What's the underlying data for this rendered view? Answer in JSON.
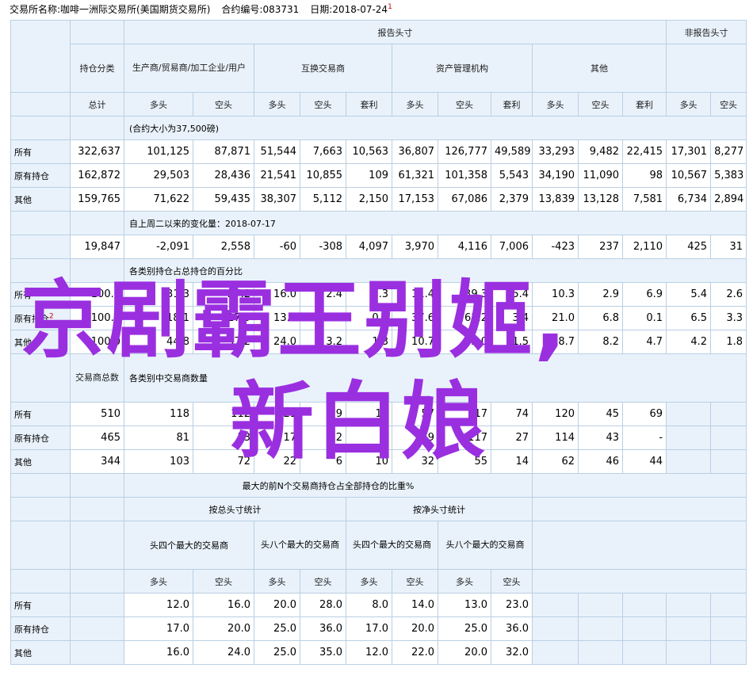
{
  "header": {
    "exchange": "交易所名称:咖啡一洲际交易所(美国期货交易所)",
    "contract": "合约编号:083731",
    "date": "日期:2018-07-24",
    "mark": "1"
  },
  "headers": {
    "report": "报告头寸",
    "nonreport": "非报告头寸",
    "holding_class": "持仓分类",
    "producer": "生产商/贸易商/加工企业/用户",
    "swap": "互换交易商",
    "money": "资产管理机构",
    "other": "其他",
    "total": "总计",
    "long": "多头",
    "short": "空头",
    "spread": "套利"
  },
  "rows": {
    "all": "所有",
    "old": "原有持仓",
    "other": "其他"
  },
  "section1": {
    "note": "(合约大小为37,500磅)",
    "data": [
      [
        "322,637",
        "101,125",
        "87,871",
        "51,544",
        "7,663",
        "10,563",
        "36,807",
        "126,777",
        "49,589",
        "33,293",
        "9,482",
        "22,415",
        "17,301",
        "8,277"
      ],
      [
        "162,872",
        "29,503",
        "28,436",
        "21,541",
        "10,855",
        "109",
        "61,321",
        "101,358",
        "5,543",
        "34,190",
        "11,090",
        "98",
        "10,567",
        "5,383"
      ],
      [
        "159,765",
        "71,622",
        "59,435",
        "38,307",
        "5,112",
        "2,150",
        "17,153",
        "67,086",
        "2,379",
        "13,839",
        "13,128",
        "7,581",
        "6,734",
        "2,894"
      ]
    ]
  },
  "section2": {
    "note": "自上周二以来的变化量：2018-07-17",
    "data": [
      "19,847",
      "-2,091",
      "2,558",
      "-60",
      "-308",
      "4,097",
      "3,970",
      "4,116",
      "7,006",
      "-423",
      "237",
      "2,110",
      "425",
      "31"
    ]
  },
  "section3": {
    "note": "各类别持仓占总持仓的百分比",
    "mark": "2",
    "data": [
      [
        "100.0",
        "31.3",
        "27.2",
        "16.0",
        "2.4",
        "3.3",
        "11.4",
        "39.3",
        "15.4",
        "10.3",
        "2.9",
        "6.9",
        "5.4",
        "2.6"
      ],
      [
        "100.0",
        "18.1",
        "17.5",
        "13.2",
        "6.7",
        "0.1",
        "37.6",
        "62.2",
        "3.4",
        "21.0",
        "6.8",
        "0.1",
        "6.5",
        "3.3"
      ],
      [
        "100.0",
        "44.8",
        "37.2",
        "24.0",
        "3.2",
        "1.3",
        "10.7",
        "42.0",
        "1.5",
        "8.7",
        "8.2",
        "4.7",
        "4.2",
        "1.8"
      ]
    ]
  },
  "section4": {
    "trader_total": "交易商总数",
    "note": "各类别中交易商数量",
    "data": [
      [
        "510",
        "118",
        "112",
        "21",
        "9",
        "17",
        "57",
        "117",
        "74",
        "120",
        "45",
        "69"
      ],
      [
        "465",
        "81",
        "53",
        "17",
        "12",
        "-",
        "69",
        "117",
        "27",
        "114",
        "43",
        "-"
      ],
      [
        "344",
        "103",
        "72",
        "22",
        "6",
        "10",
        "32",
        "55",
        "14",
        "62",
        "46",
        "44"
      ]
    ]
  },
  "section5": {
    "title": "最大的前N个交易商持仓占全部持仓的比重%",
    "gross": "按总头寸统计",
    "net": "按净头寸统计",
    "top4": "头四个最大的交易商",
    "top8": "头八个最大的交易商",
    "data": [
      [
        "12.0",
        "16.0",
        "20.0",
        "28.0",
        "8.0",
        "14.0",
        "13.0",
        "23.0"
      ],
      [
        "17.0",
        "20.0",
        "25.0",
        "36.0",
        "17.0",
        "20.0",
        "25.0",
        "36.0"
      ],
      [
        "16.0",
        "24.0",
        "25.0",
        "35.0",
        "12.0",
        "22.0",
        "20.0",
        "32.0"
      ]
    ]
  },
  "watermark": {
    "line1": "京剧霸王别姬,",
    "line2": "新白娘"
  }
}
